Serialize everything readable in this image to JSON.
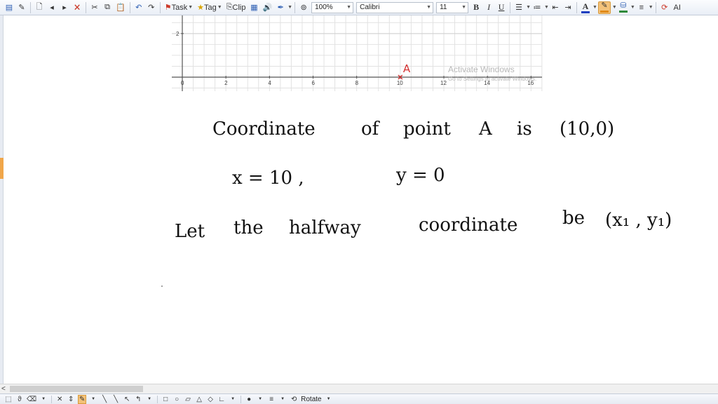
{
  "toolbar": {
    "task_label": "Task",
    "tag_label": "Tag",
    "clip_label": "Clip",
    "zoom_value": "100%",
    "font_name": "Calibri",
    "font_size": "11",
    "bold_label": "B",
    "italic_label": "I",
    "underline_label": "U",
    "font_color_label": "A",
    "text_effect_label": "AI",
    "colors": {
      "font_color": "#1f3fbf",
      "highlight": "#e08a1a",
      "fill": "#2f8a3a"
    }
  },
  "graph": {
    "x_tick_labels": [
      "0",
      "2",
      "4",
      "6",
      "8",
      "10",
      "12",
      "14",
      "16"
    ],
    "y_tick_labels": [
      "2"
    ],
    "point_label": "A",
    "point": {
      "x": 10,
      "y": 0
    },
    "x_range": [
      0,
      16
    ],
    "point_color": "#d33030"
  },
  "watermark": {
    "line1": "Activate Windows",
    "line2": "Go to Settings to activate Windows."
  },
  "notes": {
    "line1": {
      "w1": "Coordinate",
      "w2": "of",
      "w3": "point",
      "w4": "A",
      "w5": "is",
      "w6": "(10,0)"
    },
    "line2": {
      "x_eq": "x = 10 ,",
      "y_eq": "y = 0"
    },
    "line3": {
      "w1": "Let",
      "w2": "the",
      "w3": "halfway",
      "w4": "coordinate",
      "w5": "be",
      "w6": "(x₁ , y₁)"
    }
  },
  "bottom_toolbar": {
    "rotate_label": "Rotate"
  },
  "scrollbar": {
    "left_arrow": "<"
  }
}
